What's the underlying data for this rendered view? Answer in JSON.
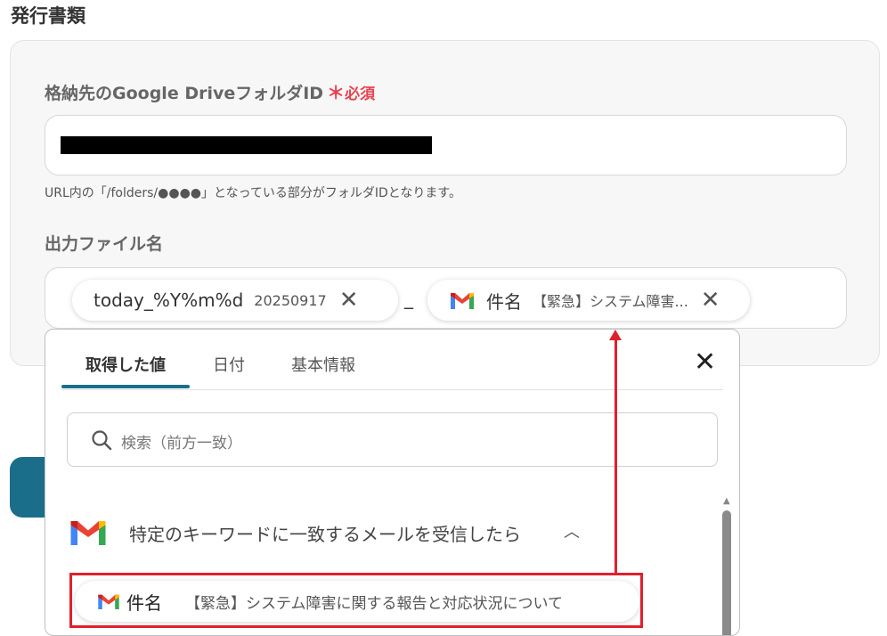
{
  "section_title": "発行書類",
  "folder_field": {
    "label": "格納先のGoogle DriveフォルダID",
    "required_star": "＊",
    "required_text": "必須",
    "hint": "URL内の「/folders/●●●●」となっている部分がフォルダIDとなります。"
  },
  "filename_field": {
    "label": "出力ファイル名",
    "chips": [
      {
        "name": "today_%Y%m%d",
        "value": "20250917",
        "remove": "✕"
      },
      {
        "name": "件名",
        "value": "【緊急】システム障害...",
        "remove": "✕"
      }
    ],
    "separator": "_"
  },
  "dropdown": {
    "tabs": [
      "取得した値",
      "日付",
      "基本情報"
    ],
    "active_tab": "取得した値",
    "close": "✕",
    "search_placeholder": "検索（前方一致）",
    "group_title": "特定のキーワードに一致するメールを受信したら",
    "group_chevron": "︿",
    "items": [
      {
        "name": "件名",
        "value": "【緊急】システム障害に関する報告と対応状況について"
      }
    ]
  },
  "colors": {
    "accent": "#1b6e8a",
    "required": "#e8444f",
    "annotation": "#e0202d"
  },
  "icons": {
    "gmail": "gmail-icon",
    "search": "search-icon",
    "close": "close-icon",
    "chevron": "chevron-up-icon"
  }
}
